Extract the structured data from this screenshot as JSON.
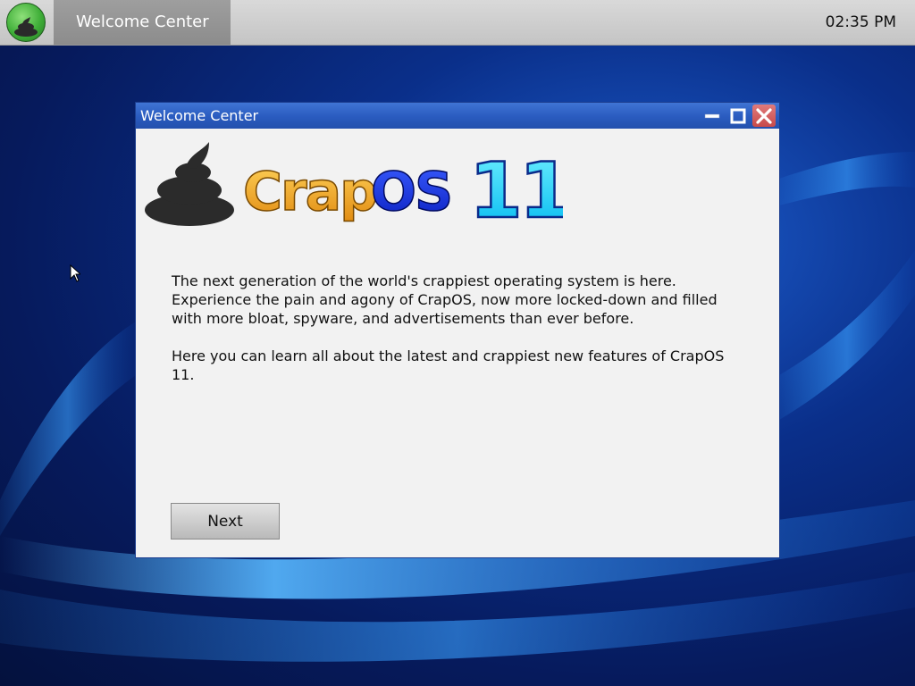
{
  "taskbar": {
    "start_icon": "poop-orb-icon",
    "active_task_label": "Welcome Center",
    "clock": "02:35 PM"
  },
  "window": {
    "title": "Welcome Center",
    "controls": {
      "minimize_icon": "minimize-icon",
      "maximize_icon": "maximize-icon",
      "close_icon": "close-icon"
    },
    "logo": {
      "word_crap": "Crap",
      "word_os": "OS",
      "version": "11"
    },
    "paragraphs": [
      "The next generation of the world's crappiest operating system is here. Experience the pain and agony of CrapOS, now more locked-down and filled with more bloat, spyware, and advertisements than ever before.",
      "Here you can learn all about the latest and crappiest new features of CrapOS 11."
    ],
    "next_button_label": "Next"
  },
  "colors": {
    "titlebar": "#2a5bbf",
    "window_bg": "#f2f2f2",
    "taskbar": "#cccccc",
    "logo_crap": "#f0a020",
    "logo_os": "#1535e0",
    "logo_version": "#10d8ff"
  }
}
